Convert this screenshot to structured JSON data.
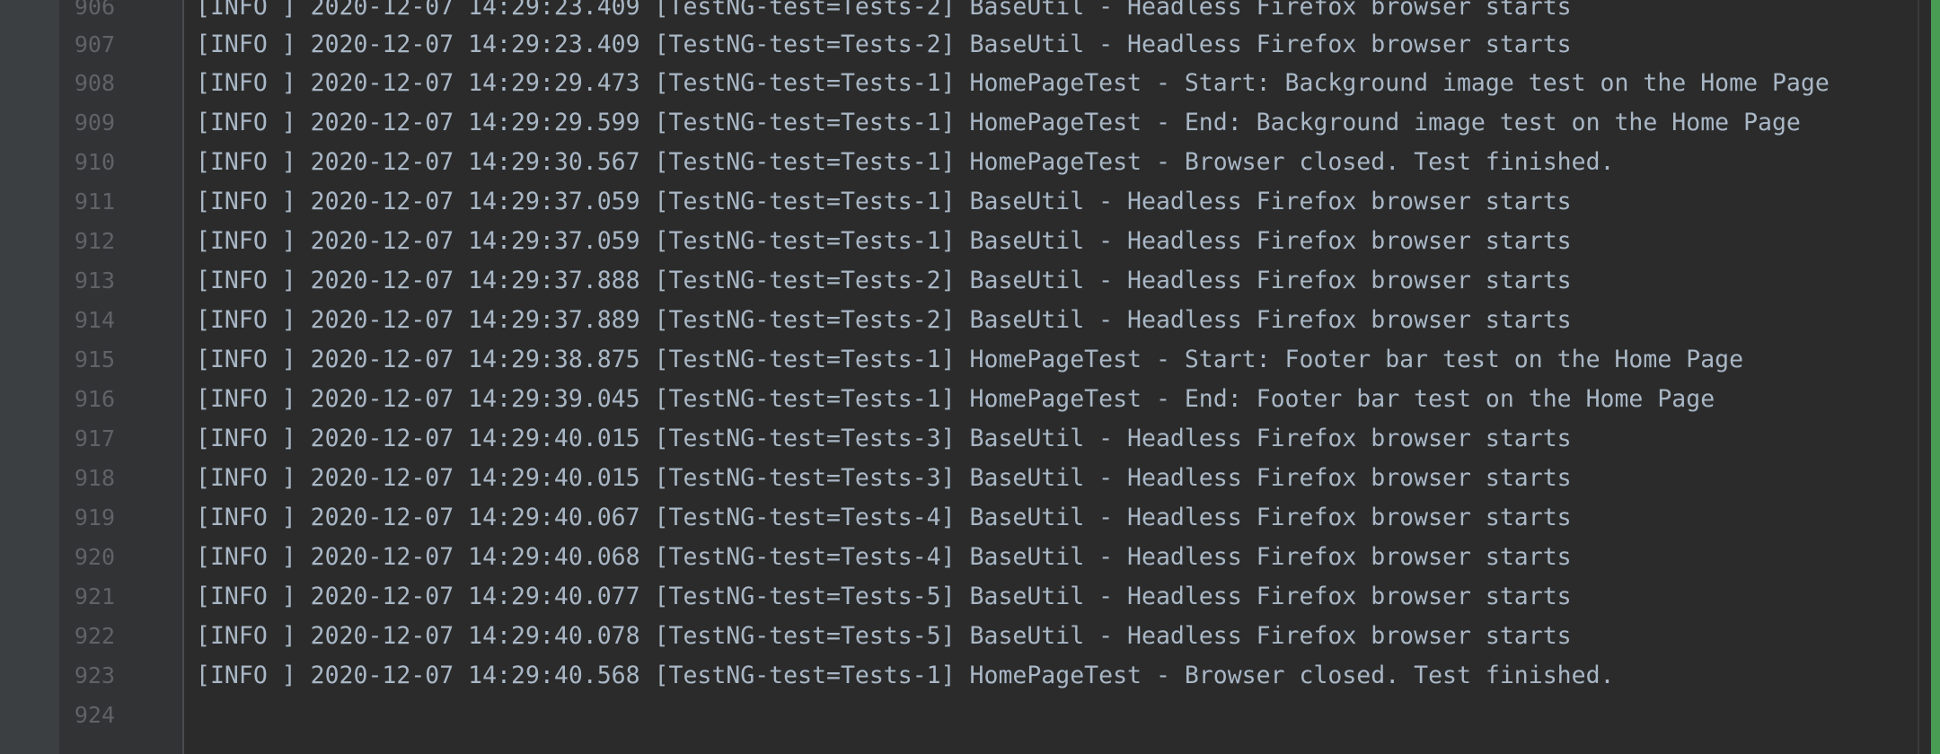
{
  "editor": {
    "accent_color": "#499c54",
    "lines": [
      {
        "number": "906",
        "text": "[INFO ] 2020-12-07 14:29:23.409 [TestNG-test=Tests-2] BaseUtil - Headless Firefox browser starts"
      },
      {
        "number": "907",
        "text": "[INFO ] 2020-12-07 14:29:23.409 [TestNG-test=Tests-2] BaseUtil - Headless Firefox browser starts"
      },
      {
        "number": "908",
        "text": "[INFO ] 2020-12-07 14:29:29.473 [TestNG-test=Tests-1] HomePageTest - Start: Background image test on the Home Page"
      },
      {
        "number": "909",
        "text": "[INFO ] 2020-12-07 14:29:29.599 [TestNG-test=Tests-1] HomePageTest - End: Background image test on the Home Page"
      },
      {
        "number": "910",
        "text": "[INFO ] 2020-12-07 14:29:30.567 [TestNG-test=Tests-1] HomePageTest - Browser closed. Test finished."
      },
      {
        "number": "911",
        "text": "[INFO ] 2020-12-07 14:29:37.059 [TestNG-test=Tests-1] BaseUtil - Headless Firefox browser starts"
      },
      {
        "number": "912",
        "text": "[INFO ] 2020-12-07 14:29:37.059 [TestNG-test=Tests-1] BaseUtil - Headless Firefox browser starts"
      },
      {
        "number": "913",
        "text": "[INFO ] 2020-12-07 14:29:37.888 [TestNG-test=Tests-2] BaseUtil - Headless Firefox browser starts"
      },
      {
        "number": "914",
        "text": "[INFO ] 2020-12-07 14:29:37.889 [TestNG-test=Tests-2] BaseUtil - Headless Firefox browser starts"
      },
      {
        "number": "915",
        "text": "[INFO ] 2020-12-07 14:29:38.875 [TestNG-test=Tests-1] HomePageTest - Start: Footer bar test on the Home Page"
      },
      {
        "number": "916",
        "text": "[INFO ] 2020-12-07 14:29:39.045 [TestNG-test=Tests-1] HomePageTest - End: Footer bar test on the Home Page"
      },
      {
        "number": "917",
        "text": "[INFO ] 2020-12-07 14:29:40.015 [TestNG-test=Tests-3] BaseUtil - Headless Firefox browser starts"
      },
      {
        "number": "918",
        "text": "[INFO ] 2020-12-07 14:29:40.015 [TestNG-test=Tests-3] BaseUtil - Headless Firefox browser starts"
      },
      {
        "number": "919",
        "text": "[INFO ] 2020-12-07 14:29:40.067 [TestNG-test=Tests-4] BaseUtil - Headless Firefox browser starts"
      },
      {
        "number": "920",
        "text": "[INFO ] 2020-12-07 14:29:40.068 [TestNG-test=Tests-4] BaseUtil - Headless Firefox browser starts"
      },
      {
        "number": "921",
        "text": "[INFO ] 2020-12-07 14:29:40.077 [TestNG-test=Tests-5] BaseUtil - Headless Firefox browser starts"
      },
      {
        "number": "922",
        "text": "[INFO ] 2020-12-07 14:29:40.078 [TestNG-test=Tests-5] BaseUtil - Headless Firefox browser starts"
      },
      {
        "number": "923",
        "text": "[INFO ] 2020-12-07 14:29:40.568 [TestNG-test=Tests-1] HomePageTest - Browser closed. Test finished."
      },
      {
        "number": "924",
        "text": ""
      }
    ]
  }
}
